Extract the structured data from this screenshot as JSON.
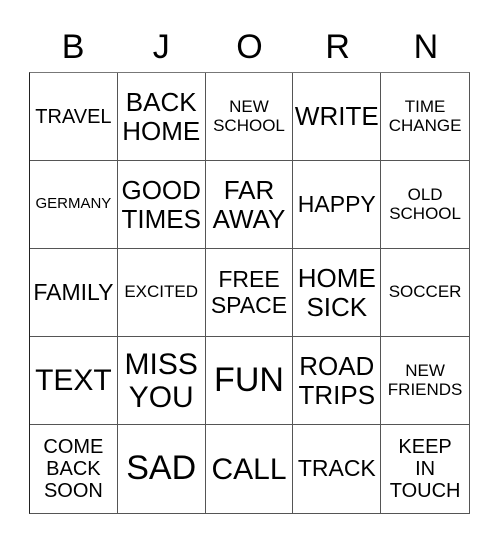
{
  "title_letters": [
    "B",
    "J",
    "O",
    "R",
    "N"
  ],
  "cells": [
    [
      "TRAVEL",
      "BACK\nHOME",
      "NEW\nSCHOOL",
      "WRITE",
      "TIME\nCHANGE"
    ],
    [
      "GERMANY",
      "GOOD\nTIMES",
      "FAR\nAWAY",
      "HAPPY",
      "OLD\nSCHOOL"
    ],
    [
      "FAMILY",
      "EXCITED",
      "FREE\nSPACE",
      "HOME\nSICK",
      "SOCCER"
    ],
    [
      "TEXT",
      "MISS\nYOU",
      "FUN",
      "ROAD\nTRIPS",
      "NEW\nFRIENDS"
    ],
    [
      "COME\nBACK\nSOON",
      "SAD",
      "CALL",
      "TRACK",
      "KEEP\nIN\nTOUCH"
    ]
  ]
}
